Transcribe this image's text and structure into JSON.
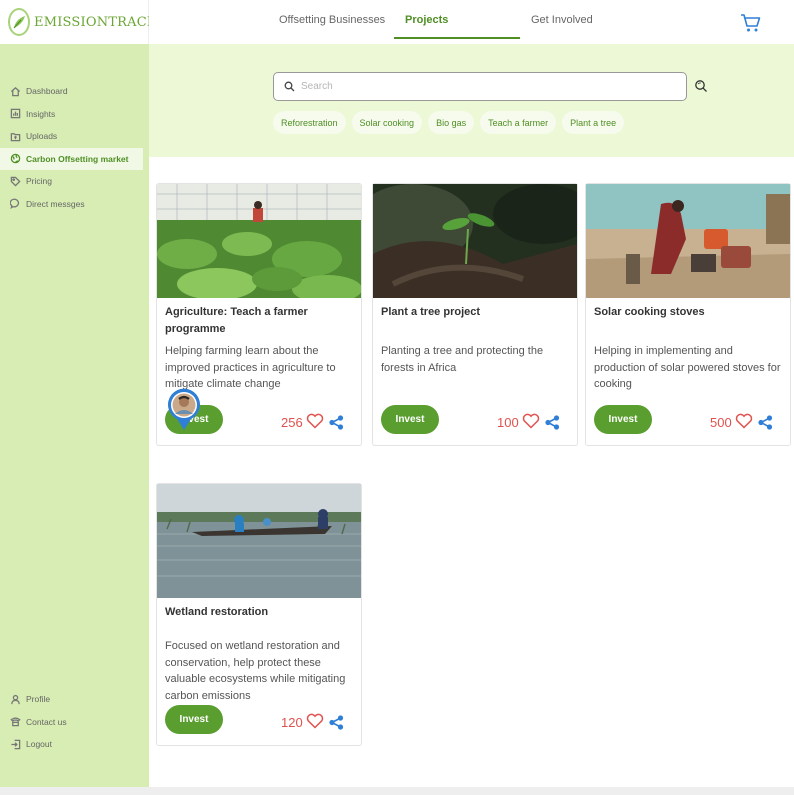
{
  "brand": {
    "name": "EMISSIONTRACK"
  },
  "topnav": {
    "tabs": [
      {
        "label": "Offsetting Businesses"
      },
      {
        "label": "Projects"
      },
      {
        "label": "Get Involved"
      }
    ],
    "active_tab": "Projects",
    "cart_icon": "cart-icon"
  },
  "sidebar": {
    "items": [
      {
        "label": "Dashboard",
        "icon": "home-icon"
      },
      {
        "label": "Insights",
        "icon": "chart-icon"
      },
      {
        "label": "Uploads",
        "icon": "upload-icon"
      },
      {
        "label": "Carbon Offsetting market",
        "icon": "globe-icon"
      },
      {
        "label": "Pricing",
        "icon": "tag-icon"
      },
      {
        "label": "Direct messges",
        "icon": "message-icon"
      }
    ],
    "active_item": "Carbon Offsetting market",
    "bottom_items": [
      {
        "label": "Profile",
        "icon": "user-icon"
      },
      {
        "label": "Contact us",
        "icon": "phone-icon"
      },
      {
        "label": "Logout",
        "icon": "logout-icon"
      }
    ]
  },
  "search": {
    "placeholder": "Search",
    "value": ""
  },
  "filters": [
    "Reforestration",
    "Solar cooking",
    "Bio gas",
    "Teach a farmer",
    "Plant a tree"
  ],
  "projects": [
    {
      "title": "Agriculture: Teach a farmer programme",
      "description": "Helping farming learn about the improved practices in agriculture to mitigate climate change",
      "invest_label": "Invest",
      "likes": "256"
    },
    {
      "title": "Plant a tree project",
      "description": "Planting a tree  and protecting the forests in Africa",
      "invest_label": "Invest",
      "likes": "100"
    },
    {
      "title": "Solar cooking stoves",
      "description": "Helping in implementing and production of solar powered stoves for cooking",
      "invest_label": "Invest",
      "likes": "500"
    },
    {
      "title": "Wetland restoration",
      "description": "Focused on wetland restoration and conservation, help protect these valuable ecosystems while mitigating carbon emissions",
      "invest_label": "Invest",
      "likes": "120"
    }
  ],
  "colors": {
    "brand_green": "#4f8f24",
    "sidebar_bg": "#d7edb3",
    "band_bg": "#ecf8d6",
    "button_green": "#5a9e2f",
    "like_red": "#e0524f",
    "share_blue": "#2f7fd6"
  }
}
